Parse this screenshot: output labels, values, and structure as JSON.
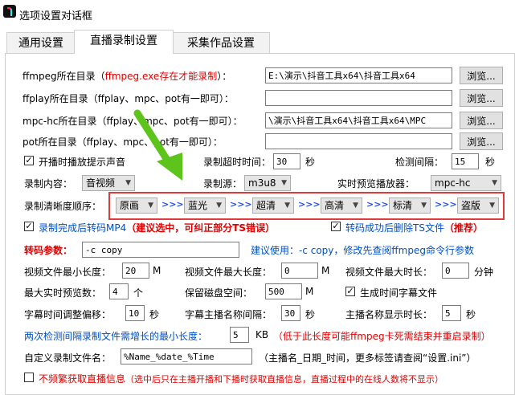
{
  "window": {
    "title": "选项设置对话框"
  },
  "tabs": [
    "通用设置",
    "直播录制设置",
    "采集作品设置"
  ],
  "paths": {
    "ffmpeg_label_a": "ffmpeg所在目录（",
    "ffmpeg_label_red": "ffmpeg.exe存在才能录制",
    "ffmpeg_label_b": "）：",
    "ffmpeg_value": "E:\\演示\\抖音工具x64\\抖音工具x64",
    "ffplay_label": "ffplay所在目录（ffplay、mpc、pot有一即可）：",
    "ffplay_value": "",
    "mpchc_label": "mpc-hc所在目录（ffplay、mpc、pot有一即可）：",
    "mpchc_value": "\\演示\\抖音工具x64\\抖音工具x64\\MPC",
    "pot_label": "pot所在目录（ffplay、mpc、pot有一即可）：",
    "pot_value": "",
    "browse": "浏览..."
  },
  "options": {
    "prompt_sound": "开播时播放提示声音",
    "timeout_label": "录制超时时间：",
    "timeout_value": "30",
    "seconds": "秒",
    "interval_label": "检测间隔：",
    "interval_value": "15",
    "content_label": "录制内容：",
    "content_value": "音视频",
    "source_label": "录制源：",
    "source_value": "m3u8",
    "player_label": "实时预览播放器：",
    "player_value": "mpc-hc"
  },
  "quality": {
    "label": "录制清晰度顺序：",
    "items": [
      "原画",
      "蓝光",
      "超清",
      "高清",
      "标清",
      "盗版"
    ],
    "sep": ">>>"
  },
  "convert": {
    "mp4_text": "录制完成后转码MP4",
    "mp4_note": "（建议选中，可纠正部分TS错误）",
    "delete_ts_text": "转码成功后删除TS文件",
    "delete_ts_note": "（推荐）"
  },
  "params": {
    "label": "转码参数：",
    "value": "-c copy",
    "hint": "建议使用：-c copy，修改先查阅ffmpeg命令行参数"
  },
  "limits": {
    "min_size_label": "视频文件最小长度：",
    "min_size_value": "20",
    "max_size_label": "视频文件最大长度：",
    "max_size_value": "0",
    "max_time_label": "视频文件最大时长：",
    "max_time_value": "0",
    "unit_m": "M",
    "unit_min": "分钟",
    "preview_label": "最大实时预览数：",
    "preview_value": "4",
    "preview_unit": "个",
    "disk_label": "保留磁盘空间：",
    "disk_value": "500",
    "subtitle_gen": "生成时间字幕文件",
    "sub_offset_label": "字幕时间调整偏移：",
    "sub_offset_value": "10",
    "anchor_interval_label": "字幕主播名称间隔：",
    "anchor_interval_value": "30",
    "anchor_show_label": "主播名称显示时长：",
    "anchor_show_value": "5",
    "sec": "秒",
    "min_growth_label": "两次检测间隔录制文件需增长的最小长度：",
    "min_growth_value": "5",
    "kb": "KB",
    "min_growth_note": "（低于此长度可能ffmpeg卡死需结束并重启录制）"
  },
  "filename": {
    "label": "自定义录制文件名：",
    "value": "%Name_%date_%Time",
    "hint": "（主播名_日期_时间，更多标签请查阅“设置.ini”）"
  },
  "freq": {
    "text": "不频繁获取直播信息",
    "note": "（选中后只在主播开播和下播时获取直播信息，直播过程中的在线人数将不显示）"
  }
}
